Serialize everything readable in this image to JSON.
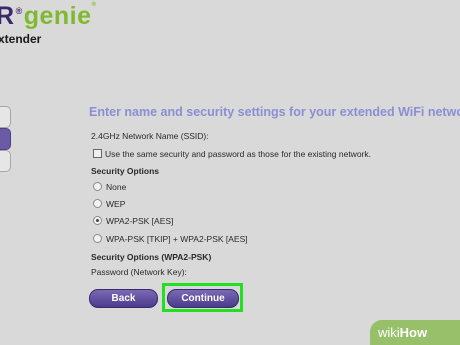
{
  "header": {
    "brand_partial": "R",
    "registered_mark": "®",
    "product": "genie",
    "product_mark": "®",
    "subtitle": "xtender"
  },
  "main": {
    "heading": "Enter name and security settings for your extended WiFi network.",
    "ssid_label": "2.4GHz Network Name (SSID):",
    "same_security_label": "Use the same security and password as those for the existing network.",
    "security_options_title": "Security Options",
    "options": [
      {
        "label": "None",
        "selected": false
      },
      {
        "label": "WEP",
        "selected": false
      },
      {
        "label": "WPA2-PSK [AES]",
        "selected": true
      },
      {
        "label": "WPA-PSK [TKIP] + WPA2-PSK [AES]",
        "selected": false
      }
    ],
    "security_options_wpa2_title": "Security Options (WPA2-PSK)",
    "password_label": "Password (Network Key):"
  },
  "buttons": {
    "back": "Back",
    "continue": "Continue"
  },
  "watermark": {
    "wiki": "wiki",
    "how": "How"
  },
  "colors": {
    "heading": "#8d8dd4",
    "button": "#5a4a9c",
    "highlight": "#22e01f",
    "genie_green": "#7fb92f"
  }
}
